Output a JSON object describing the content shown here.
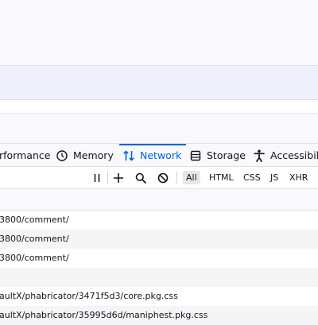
{
  "devtools": {
    "tabs": [
      {
        "label": "rformance",
        "icon": "performance-icon"
      },
      {
        "label": "Memory",
        "icon": "memory-icon"
      },
      {
        "label": "Network",
        "icon": "network-arrows-icon",
        "active": true
      },
      {
        "label": "Storage",
        "icon": "storage-icon"
      },
      {
        "label": "Accessibilit",
        "icon": "accessibility-icon"
      }
    ],
    "accent_color": "#0061e0"
  },
  "network_toolbar": {
    "filters": [
      "All",
      "HTML",
      "CSS",
      "JS",
      "XHR"
    ],
    "active_filter": "All",
    "icons": [
      "pause-icon",
      "plus-icon",
      "search-icon",
      "block-icon"
    ]
  },
  "requests": [
    {
      "url": "3800/comment/"
    },
    {
      "url": "3800/comment/"
    },
    {
      "url": "3800/comment/"
    },
    {
      "url": ""
    },
    {
      "url": "aultX/phabricator/3471f5d3/core.pkg.css"
    },
    {
      "url": "aultX/phabricator/35995d6d/maniphest.pkg.css"
    }
  ]
}
